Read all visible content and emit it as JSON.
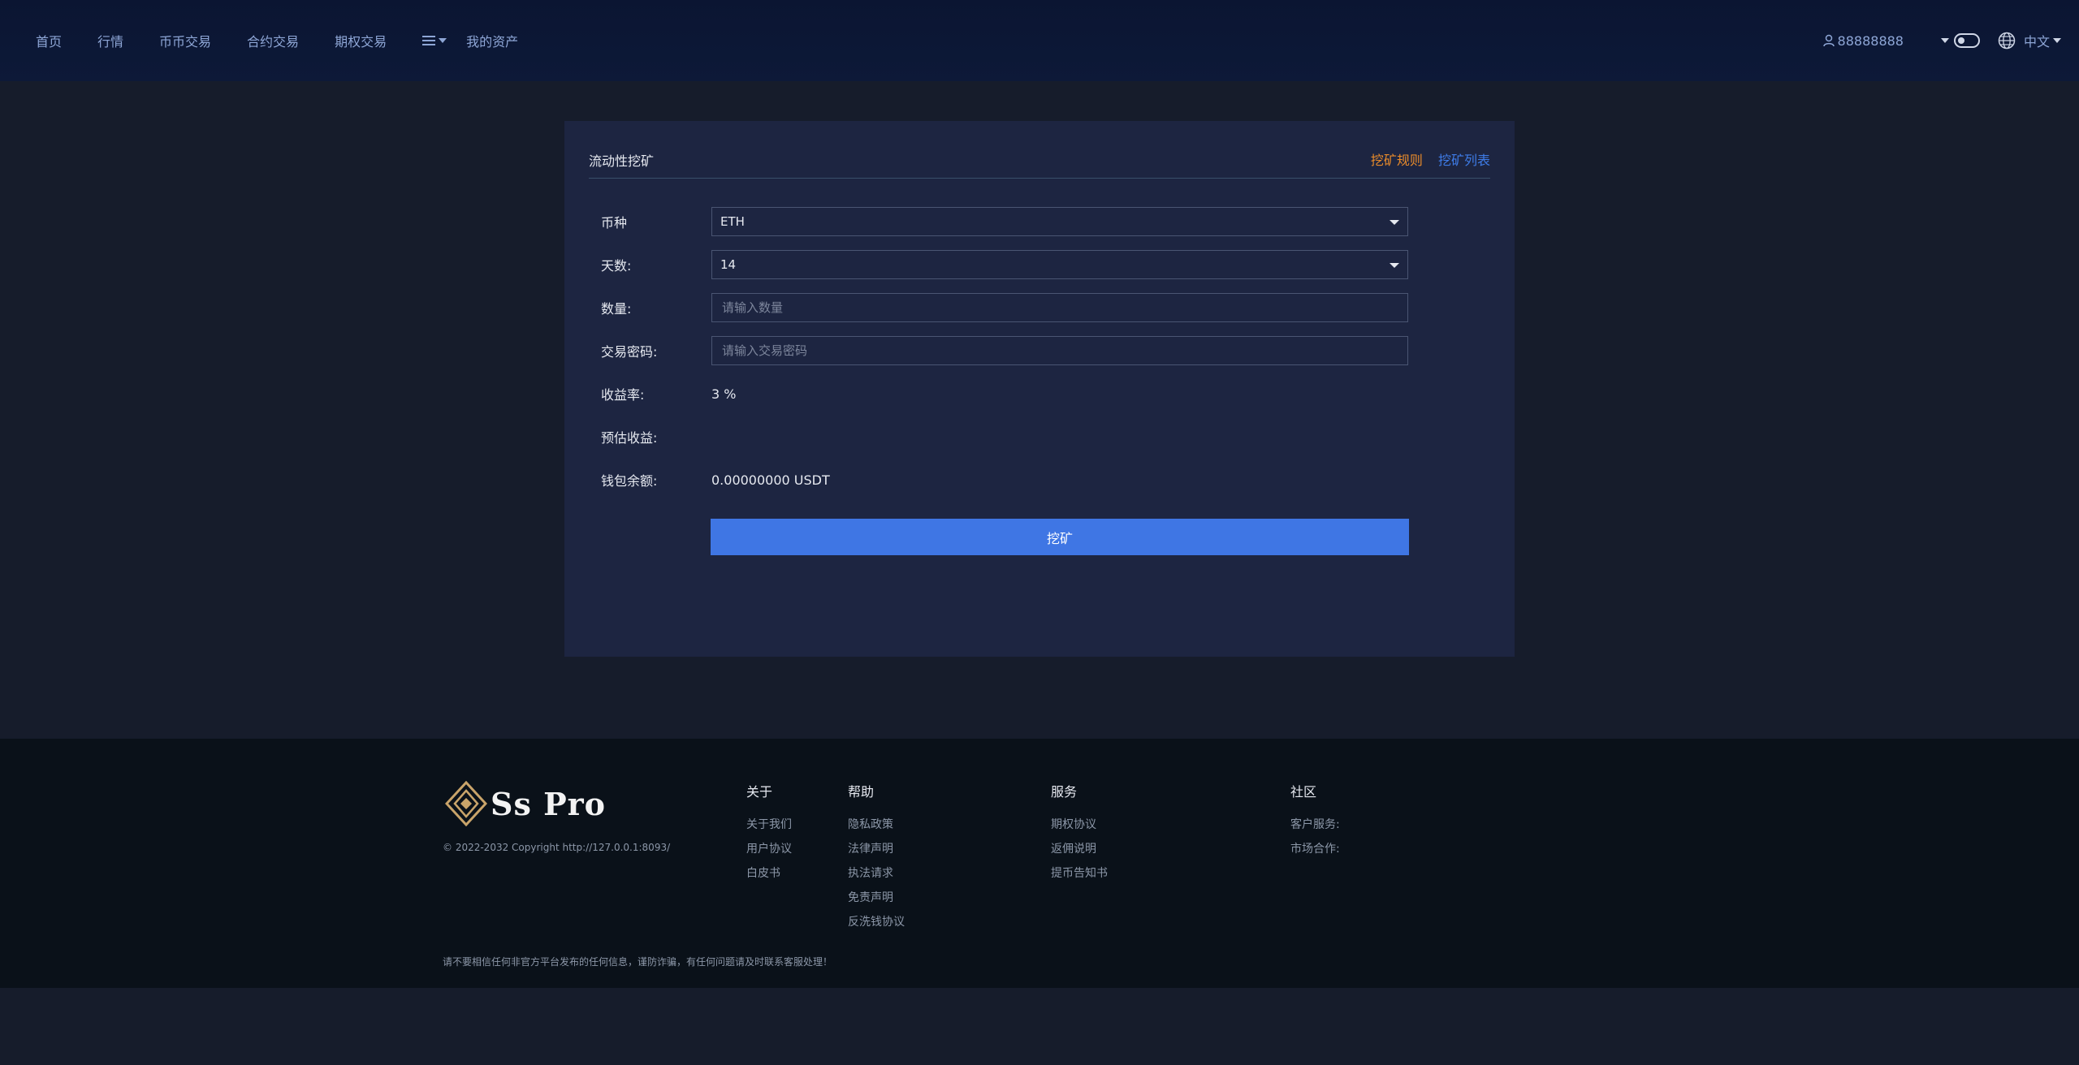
{
  "header": {
    "nav": [
      "首页",
      "行情",
      "币币交易",
      "合约交易",
      "期权交易"
    ],
    "assets": "我的资产",
    "user": "88888888",
    "lang": "中文"
  },
  "mining": {
    "title": "流动性挖矿",
    "rules_link": "挖矿规则",
    "list_link": "挖矿列表",
    "coin_label": "币种",
    "coin_value": "ETH",
    "days_label": "天数:",
    "days_value": "14",
    "amount_label": "数量:",
    "amount_placeholder": "请输入数量",
    "password_label": "交易密码:",
    "password_placeholder": "请输入交易密码",
    "rate_label": "收益率:",
    "rate_value": "3 %",
    "estimate_label": "预估收益:",
    "estimate_value": "",
    "balance_label": "钱包余额:",
    "balance_value": "0.00000000 USDT",
    "submit": "挖矿"
  },
  "footer": {
    "logo_text": "Ss Pro",
    "copyright": "© 2022-2032 Copyright http://127.0.0.1:8093/",
    "columns": [
      {
        "title": "关于",
        "items": [
          "关于我们",
          "用户协议",
          "白皮书"
        ]
      },
      {
        "title": "帮助",
        "items": [
          "隐私政策",
          "法律声明",
          "执法请求",
          "免责声明",
          "反洗钱协议"
        ]
      },
      {
        "title": "服务",
        "items": [
          "期权协议",
          "返佣说明",
          "提币告知书"
        ]
      },
      {
        "title": "社区",
        "items": [
          "客户服务:",
          "市场合作:"
        ]
      }
    ],
    "warning": "请不要相信任何非官方平台发布的任何信息，谨防诈骗，有任何问题请及时联系客服处理！"
  },
  "colors": {
    "accent": "#3f76e4",
    "rules_link": "#e98b2a",
    "list_link": "#3e7ce8"
  },
  "icons": [
    "menu-list-icon",
    "user-icon",
    "caret-down-icon",
    "theme-toggle-icon",
    "globe-icon",
    "logo-diamond-icon"
  ]
}
